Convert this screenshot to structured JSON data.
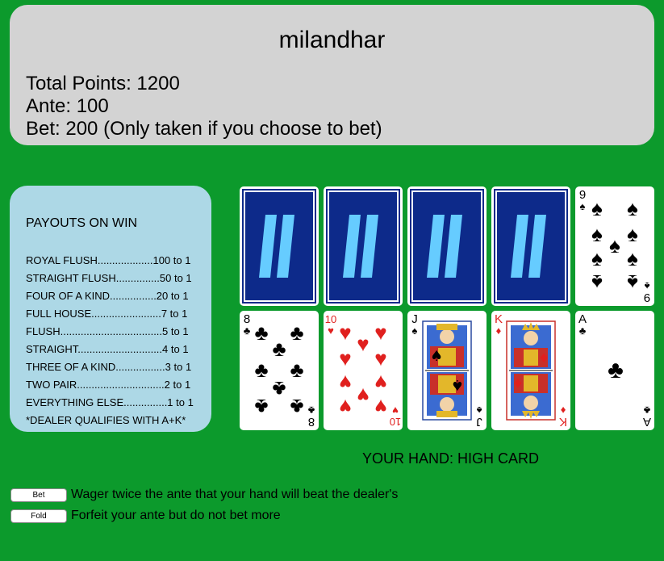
{
  "header": {
    "username": "milandhar",
    "total_points": "Total Points: 1200",
    "ante": "Ante: 100",
    "bet": "Bet: 200 (Only taken if you choose to bet)"
  },
  "payouts": {
    "title": "PAYOUTS ON WIN",
    "rows": [
      "ROYAL FLUSH...................100 to 1",
      "STRAIGHT FLUSH...............50 to 1",
      "FOUR OF A KIND................20 to 1",
      "FULL HOUSE........................7 to 1",
      "FLUSH...................................5 to 1",
      "STRAIGHT.............................4 to 1",
      "THREE OF A KIND.................3 to 1",
      "TWO PAIR..............................2 to 1",
      "EVERYTHING ELSE...............1 to 1"
    ],
    "note": "*DEALER QUALIFIES WITH A+K*"
  },
  "dealer_cards": [
    {
      "face": "down"
    },
    {
      "face": "down"
    },
    {
      "face": "down"
    },
    {
      "face": "down"
    },
    {
      "face": "up",
      "rank": "9",
      "suit": "spades"
    }
  ],
  "player_cards": [
    {
      "rank": "8",
      "suit": "clubs"
    },
    {
      "rank": "10",
      "suit": "hearts"
    },
    {
      "rank": "J",
      "suit": "spades"
    },
    {
      "rank": "K",
      "suit": "diamonds"
    },
    {
      "rank": "A",
      "suit": "clubs"
    }
  ],
  "hand": {
    "label": "YOUR HAND: HIGH CARD"
  },
  "actions": {
    "bet_label": "Bet",
    "bet_desc": "Wager twice the ante that your hand will beat the dealer's",
    "fold_label": "Fold",
    "fold_desc": "Forfeit your ante but do not bet more"
  },
  "colors": {
    "table_green": "#0c9a2c",
    "header_gray": "#d3d3d3",
    "payout_blue": "#add8e6",
    "card_back_blue": "#0d2a8a",
    "card_back_stripe": "#66ccff",
    "red_suit": "#e0201e"
  }
}
